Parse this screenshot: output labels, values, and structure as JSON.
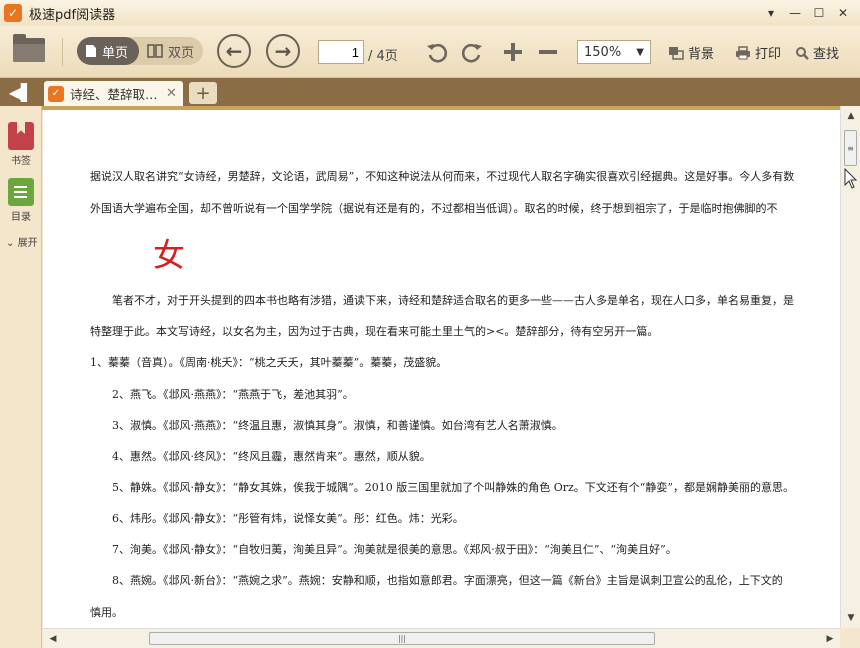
{
  "titlebar": {
    "app_title": "极速pdf阅读器",
    "logo_glyph": "✓",
    "controls": [
      "▾",
      "—",
      "☐",
      "✕"
    ]
  },
  "toolbar": {
    "view_single": "单页",
    "view_double": "双页",
    "prev_glyph": "←",
    "next_glyph": "→",
    "current_page": "1",
    "total_pages": "/ 4页",
    "zoom": "150%",
    "background_label": "背景",
    "print_label": "打印",
    "find_label": "查找"
  },
  "tabs": {
    "collapse_glyph": "◀▌",
    "doc_tab_label": "诗经、楚辞取…",
    "close_glyph": "✕",
    "new_tab_glyph": "+"
  },
  "sidebar": {
    "bookmark_label": "书签",
    "toc_label": "目录",
    "expand_label": "展开"
  },
  "document": {
    "big_char": "女",
    "lines": [
      "据说汉人取名讲究“女诗经，男楚辞，文论语，武周易”，不知这种说法从何而来，不过现代人取名字确实很喜欢引经据典。这是好事。今人多有数",
      "外国语大学遍布全国，却不曾听说有一个国学学院（据说有还是有的，不过都相当低调）。取名的时候，终于想到祖宗了，于是临时抱佛脚的不",
      "笔者不才，对于开头提到的四本书也略有涉猎，通读下来，诗经和楚辞适合取名的更多一些——古人多是单名，现在人口多，单名易重复，是",
      "特整理于此。本文写诗经，以女名为主，因为过于古典，现在看来可能土里土气的><。楚辞部分，待有空另开一篇。",
      "1、蓁蓁（音真）。《周南·桃夭》：“桃之夭夭，其叶蓁蓁”。蓁蓁，茂盛貌。",
      "2、燕飞。《邶风·燕燕》：“燕燕于飞，差池其羽”。",
      "3、淑慎。《邶风·燕燕》：“终温且惠，淑慎其身”。淑慎，和善谨慎。如台湾有艺人名萧淑慎。",
      "4、惠然。《邶风·终风》：“终风且霾，惠然肯来”。惠然，顺从貌。",
      "5、静姝。《邶风·静女》：“静女其姝，俟我于城隅”。2010 版三国里就加了个叫静姝的角色 Orz。下文还有个“静娈”，都是娴静美丽的意思。",
      "6、炜彤。《邶风·静女》：“彤管有炜，说怿女美”。彤：红色。炜：光彩。",
      "7、洵美。《邶风·静女》：“自牧归荑，洵美且异”。洵美就是很美的意思。《郑风·叔于田》：“洵美且仁”、“洵美且好”。",
      "8、燕婉。《邶风·新台》：“燕婉之求”。燕婉：安静和顺，也指如意郎君。字面漂亮，但这一篇《新台》主旨是讽刺卫宣公的乱伦，上下文的",
      "慎用。"
    ]
  },
  "scrollbar": {
    "up": "▲",
    "down": "▼",
    "left": "◀",
    "right": "▶",
    "grip": "≡",
    "hgrip": "|||"
  }
}
